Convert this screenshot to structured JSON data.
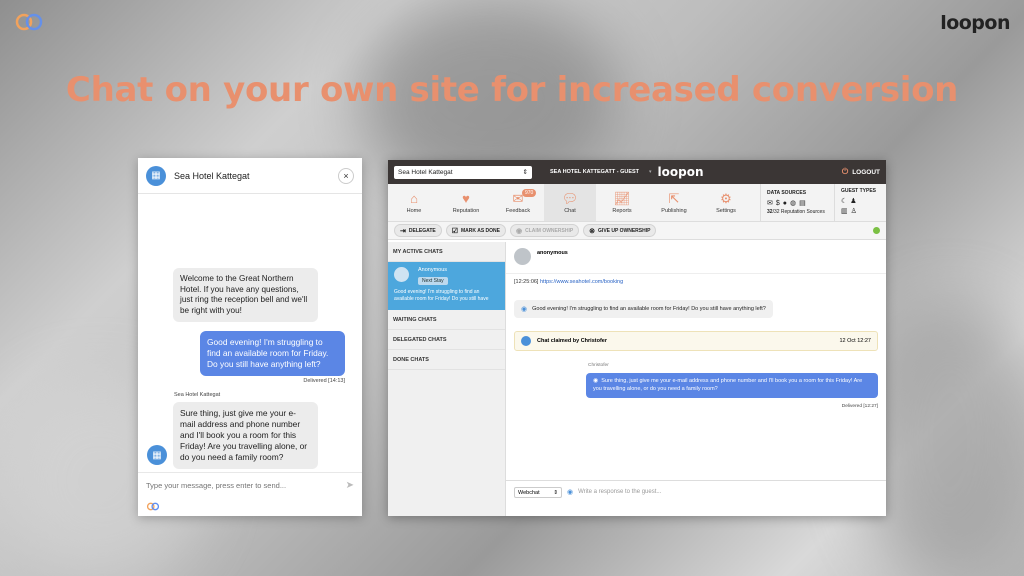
{
  "headline": "Chat on your own site for increased conversion",
  "brand": {
    "right_logo": "loopon"
  },
  "widget": {
    "title": "Sea Hotel Kattegat",
    "close": "×",
    "messages": {
      "welcome": "Welcome to the Great Northern Hotel. If you have any questions, just ring the reception bell and we'll be right with you!",
      "guest": "Good evening! I'm struggling to find an available room for Friday. Do you still have anything left?",
      "guest_meta": "Delivered [14:13]",
      "agent_label": "Sea Hotel Kattegat",
      "agent": "Sure thing, just give me your e-mail address and phone number and I'll book you a room for this Friday! Are you travelling alone, or do you need a family room?"
    },
    "input_placeholder": "Type your message, press enter to send..."
  },
  "dashboard": {
    "hotel_select": "Sea Hotel Kattegat",
    "hotel_label": "SEA HOTEL KATTEGATT - GUEST",
    "caret": "▾",
    "brand": "loopon",
    "logout": "LOGOUT",
    "nav": {
      "home": "Home",
      "reputation": "Reputation",
      "feedback": "Feedback",
      "feedback_badge": "970",
      "chat": "Chat",
      "reports": "Reports",
      "publishing": "Publishing",
      "settings": "Settings"
    },
    "data_sources": {
      "title": "DATA SOURCES",
      "count": "32",
      "count_rest": "/32 Reputation Sources"
    },
    "guest_types": {
      "title": "GUEST TYPES"
    },
    "actions": {
      "delegate": "DELEGATE",
      "mark_done": "MARK AS DONE",
      "claim": "CLAIM OWNERSHIP",
      "give_up": "GIVE UP OWNERSHIP"
    },
    "sidebar": {
      "active": "MY ACTIVE CHATS",
      "card_name": "Anonymous",
      "card_tag": "Next Stay",
      "card_msg": "Good evening! I'm struggling to find an available room for Friday! Do you still have",
      "waiting": "WAITING CHATS",
      "delegated": "DELEGATED CHATS",
      "done": "DONE CHATS"
    },
    "main": {
      "name": "anonymous",
      "time": "[12:25:06]",
      "link": "https://www.seahotel.com/booking",
      "guest_msg": "Good evening! I'm struggling to find an available room for Friday! Do you still have anything left?",
      "claim_text": "Chat claimed by Christofer",
      "claim_date": "12 Oct 12:27",
      "agent_label": "Christofer",
      "agent_msg": "Sure thing, just give me your e-mail address and phone number and I'll book you a room for this Friday! Are you travelling alone, or do you need a family room?",
      "delivered": "Delivered [12:27]",
      "channel": "Webchat",
      "response_placeholder": "Write a response to the guest..."
    }
  }
}
